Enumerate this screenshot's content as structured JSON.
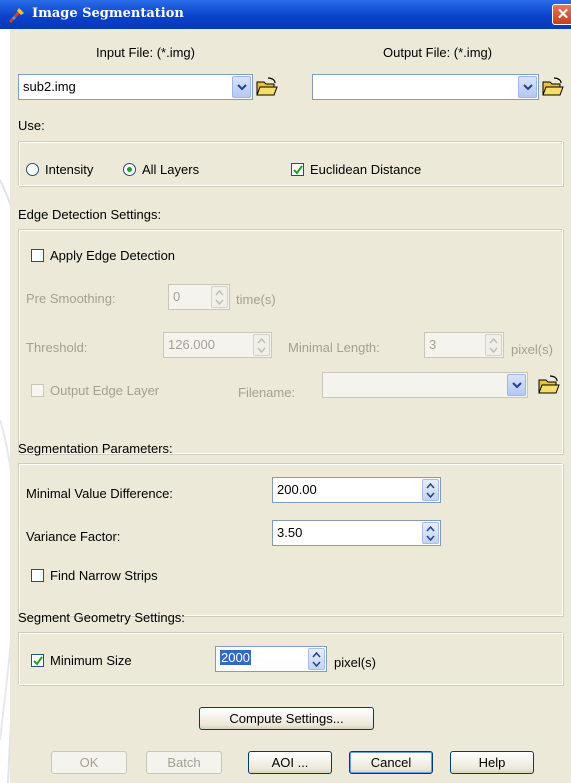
{
  "window": {
    "title": "Image Segmentation",
    "close_symbol": "✕",
    "accent": "#0a3fc8",
    "face": "#ece9d8"
  },
  "io": {
    "input_label": "Input File: (*.img)",
    "input_value": "sub2.img",
    "output_label": "Output File: (*.img)",
    "output_value": ""
  },
  "use": {
    "heading": "Use:",
    "intensity_label": "Intensity",
    "all_layers_label": "All Layers",
    "euclidean_label": "Euclidean Distance",
    "selected": "All Layers",
    "euclidean_checked": true
  },
  "edge": {
    "heading": "Edge Detection Settings:",
    "apply_label": "Apply Edge Detection",
    "apply_checked": false,
    "pre_smoothing_label": "Pre Smoothing:",
    "pre_smoothing_value": "0",
    "pre_smoothing_unit": "time(s)",
    "threshold_label": "Threshold:",
    "threshold_value": "126.000",
    "minimal_length_label": "Minimal Length:",
    "minimal_length_value": "3",
    "minimal_length_unit": "pixel(s)",
    "output_edge_label": "Output Edge Layer",
    "filename_label": "Filename:",
    "filename_value": ""
  },
  "segmentation": {
    "heading": "Segmentation Parameters:",
    "min_value_diff_label": "Minimal Value Difference:",
    "min_value_diff_value": "200.00",
    "variance_factor_label": "Variance Factor:",
    "variance_factor_value": "3.50",
    "narrow_strips_label": "Find Narrow Strips",
    "narrow_strips_checked": false
  },
  "geometry": {
    "heading": "Segment Geometry Settings:",
    "minimum_size_label": "Minimum Size",
    "minimum_size_checked": true,
    "minimum_size_value": "2000",
    "minimum_size_unit": "pixel(s)"
  },
  "buttons": {
    "compute_settings": "Compute Settings...",
    "ok": "OK",
    "batch": "Batch",
    "aoi": "AOI ...",
    "cancel": "Cancel",
    "help": "Help"
  }
}
